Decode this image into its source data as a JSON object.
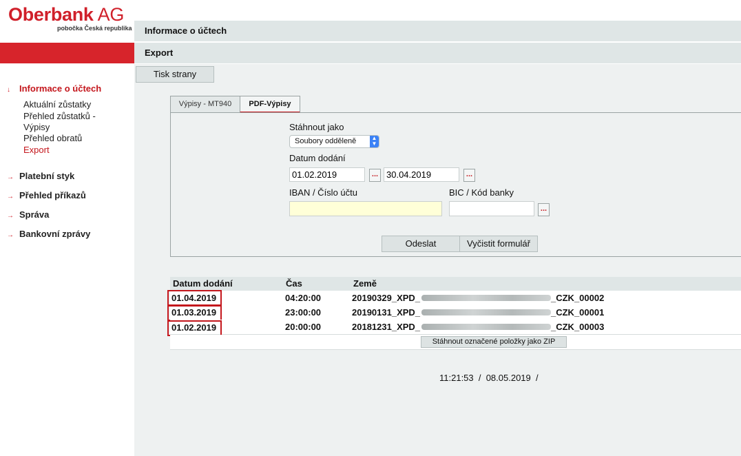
{
  "logo": {
    "brand": "Oberbank",
    "suffix": "AG",
    "subtitle": "pobočka Česká republika"
  },
  "sidebar": {
    "sections": [
      {
        "label": "Informace o účtech",
        "active": true,
        "arrow": "↓"
      },
      {
        "label": "Platební styk",
        "arrow": "→"
      },
      {
        "label": "Přehled příkazů",
        "arrow": "→"
      },
      {
        "label": "Správa",
        "arrow": "→"
      },
      {
        "label": "Bankovní zprávy",
        "arrow": "→"
      }
    ],
    "sub_items": [
      {
        "line1": "Aktuální zůstatky"
      },
      {
        "line1": "Přehled zůstatků -",
        "line2": "Výpisy"
      },
      {
        "line1": "Přehled obratů"
      },
      {
        "line1": "Export",
        "active": true
      }
    ]
  },
  "header": {
    "title": "Informace o účtech",
    "subtitle": "Export"
  },
  "toolbar": {
    "print_label": "Tisk strany"
  },
  "tabs": [
    {
      "label": "Výpisy - MT940",
      "active": false
    },
    {
      "label": "PDF-Výpisy",
      "active": true
    }
  ],
  "form": {
    "download_as_label": "Stáhnout jako",
    "download_as_value": "Soubory odděleně",
    "delivery_date_label": "Datum dodání",
    "date_from": "01.02.2019",
    "date_to": "30.04.2019",
    "picker_label": "...",
    "iban_label": "IBAN / Číslo účtu",
    "iban_value": "",
    "bic_label": "BIC / Kód banky",
    "bic_value": "",
    "submit_label": "Odeslat",
    "clear_label": "Vyčistit formulář"
  },
  "table": {
    "columns": [
      "Datum dodání",
      "Čas",
      "Země"
    ],
    "rows": [
      {
        "date": "01.04.2019",
        "time": "04:20:00",
        "file_prefix": "20190329_XPD_",
        "file_suffix": "_CZK_00002"
      },
      {
        "date": "01.03.2019",
        "time": "23:00:00",
        "file_prefix": "20190131_XPD_",
        "file_suffix": "_CZK_00001"
      },
      {
        "date": "01.02.2019",
        "time": "20:00:00",
        "file_prefix": "20181231_XPD_",
        "file_suffix": "_CZK_00003"
      }
    ],
    "zip_label": "Stáhnout označené položky jako ZIP"
  },
  "footer": {
    "timestamp": "11:21:53  /  08.05.2019  /"
  },
  "colors": {
    "brand_red": "#d7242b",
    "panel_bg": "#eef1f1",
    "bar_bg": "#dfe6e6",
    "highlight": "#c4161c"
  }
}
